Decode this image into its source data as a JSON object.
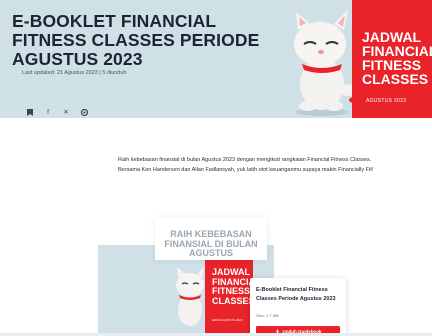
{
  "article": {
    "title": "E-BOOKLET FINANCIAL FITNESS CLASSES PERIODE AGUSTUS 2023",
    "updated": "Last updated: 21 Agustus 2023 | 5 diunduh",
    "share_icons": [
      "bookmark-icon",
      "facebook-icon",
      "x-icon",
      "link-icon"
    ]
  },
  "banner": {
    "title": "JADWAL FINANCIAL FITNESS CLASSES",
    "subtitle": "AGUSTUS 2023"
  },
  "intro": {
    "line1": "Raih kebebasan finansial di bulan Agustus 2023 dengan mengikuti rangkaian Financial Fitness Classes.",
    "line2": "Bersama Ken Handersen dan Allan Fadlansyah, yuk latih otot keuanganmu supaya makin Financially Fit!"
  },
  "thumbnail": {
    "headline": "RAIH KEBEBASAN FINANSIAL DI BULAN AGUSTUS",
    "red_title": "JADWAL FINANCIAL FITNESS CLASSES",
    "red_subtitle": "EDISI AGUSTUS 2023"
  },
  "download_card": {
    "title": "E-Booklet Financial Fitness Classes Periode Agustus 2023",
    "size": "Size: 1.7 MB",
    "button_label": "Unduh Guidebook"
  },
  "colors": {
    "brand_red": "#e8232a",
    "banner_bg": "#cfe0e7",
    "title_dark": "#1c2630"
  }
}
